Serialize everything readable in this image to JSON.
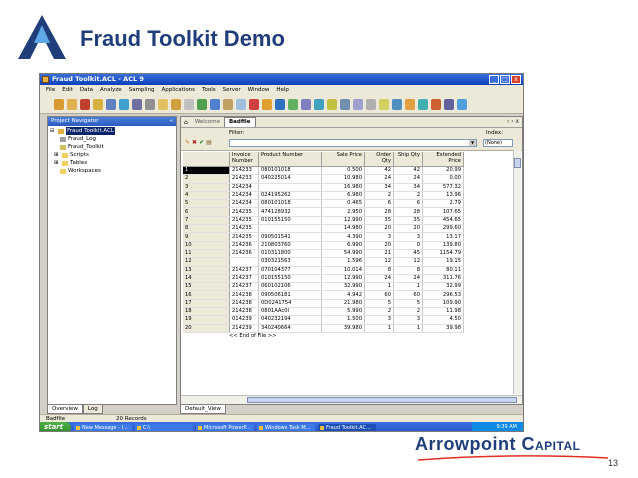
{
  "slide": {
    "title": "Fraud Toolkit Demo",
    "page_number": "13",
    "logo_text": "Arrowpoint Capital",
    "logo_main": "Arrowpoint",
    "logo_cap_first": "C",
    "logo_cap_rest": "APITAL",
    "brand_color": "#1f3e7a"
  },
  "window": {
    "title": "Fraud Toolkit.ACL - ACL 9",
    "controls": [
      "_",
      "□",
      "x"
    ]
  },
  "menu": [
    "File",
    "Edit",
    "Data",
    "Analyze",
    "Sampling",
    "Applications",
    "Tools",
    "Server",
    "Window",
    "Help"
  ],
  "navigator": {
    "title": "Project Navigator",
    "close_glyph": "«",
    "items": [
      {
        "label": "Fraud Toolkit.ACL",
        "level": 0,
        "selected": true,
        "icon": "project-icon"
      },
      {
        "label": "Fraud_Log",
        "level": 1,
        "selected": false,
        "icon": "log-icon"
      },
      {
        "label": "Fraud_Toolkit",
        "level": 1,
        "selected": false,
        "icon": "folder-icon"
      },
      {
        "label": "Scripts",
        "level": 1,
        "selected": false,
        "icon": "folder-icon"
      },
      {
        "label": "Tables",
        "level": 1,
        "selected": false,
        "icon": "folder-icon"
      },
      {
        "label": "Workspaces",
        "level": 1,
        "selected": false,
        "icon": "folder-icon"
      }
    ],
    "tabs": [
      "Overview",
      "Log"
    ]
  },
  "view": {
    "tabs": [
      {
        "label": "Welcome",
        "active": false
      },
      {
        "label": "Badfile",
        "active": true
      }
    ],
    "nav_glyphs": "‹ › x",
    "filter_label": "Filter:",
    "index_label": "Index:",
    "index_value": "(None)",
    "columns": [
      "",
      "Invoice Number",
      "Product Number",
      "Sale Price",
      "Order Qty",
      "Ship Qty",
      "Extended Price"
    ],
    "rows": [
      [
        "1",
        "214233",
        "080101018",
        "0.500",
        "42",
        "42",
        "20.99"
      ],
      [
        "2",
        "214233",
        "040225014",
        "10.980",
        "24",
        "24",
        "0.00"
      ],
      [
        "3",
        "214234",
        "",
        "16.980",
        "34",
        "34",
        "577.32"
      ],
      [
        "4",
        "214234",
        "024195262",
        "6.980",
        "2",
        "2",
        "13.96"
      ],
      [
        "5",
        "214234",
        "080101018",
        "0.465",
        "6",
        "6",
        "2.79"
      ],
      [
        "6",
        "214235",
        "474128932",
        "2.950",
        "28",
        "28",
        "107.65"
      ],
      [
        "7",
        "214235",
        "010155150",
        "12.990",
        "35",
        "35",
        "454.65"
      ],
      [
        "8",
        "214235",
        "",
        "14.980",
        "20",
        "20",
        "299.60"
      ],
      [
        "9",
        "214235",
        "090501541",
        "4.390",
        "3",
        "3",
        "13.17"
      ],
      [
        "10",
        "214236",
        "210803760",
        "6.990",
        "20",
        "0",
        "139.80"
      ],
      [
        "11",
        "214236",
        "010311800",
        "54.990",
        "21",
        "45",
        "1154.79"
      ],
      [
        "12",
        "",
        "030321563",
        "1.596",
        "12",
        "12",
        "19.15"
      ],
      [
        "13",
        "214237",
        "070104377",
        "10.014",
        "8",
        "8",
        "80.11"
      ],
      [
        "14",
        "214237",
        "010155150",
        "12.990",
        "24",
        "24",
        "311.76"
      ],
      [
        "15",
        "214237",
        "060102106",
        "32.990",
        "1",
        "1",
        "32.99"
      ],
      [
        "16",
        "214238",
        "090506181",
        "4.942",
        "60",
        "60",
        "296.53"
      ],
      [
        "17",
        "214238",
        "0D0241754",
        "21.980",
        "5",
        "5",
        "109.90"
      ],
      [
        "18",
        "214238",
        "0801AAc0l",
        "5.990",
        "2",
        "2",
        "11.98"
      ],
      [
        "19",
        "014239",
        "040232194",
        "1.500",
        "3",
        "3",
        "4.50"
      ],
      [
        "20",
        "214239",
        "340240664",
        "39.980",
        "1",
        "1",
        "39.98"
      ]
    ],
    "end_of_file": "<< End of File >>",
    "bottom_tab": "Default_View"
  },
  "status": {
    "table_name": "Badfile",
    "record_count": "20 Records"
  },
  "taskbar": {
    "start_label": "start",
    "tasks": [
      {
        "label": "New Message - I...",
        "active": false
      },
      {
        "label": "C:\\",
        "active": false
      },
      {
        "label": "Microsoft PowerP...",
        "active": false
      },
      {
        "label": "Windows Task M...",
        "active": false
      },
      {
        "label": "Fraud Toolkit.AC...",
        "active": true
      }
    ],
    "clock": "9:39 AM"
  }
}
